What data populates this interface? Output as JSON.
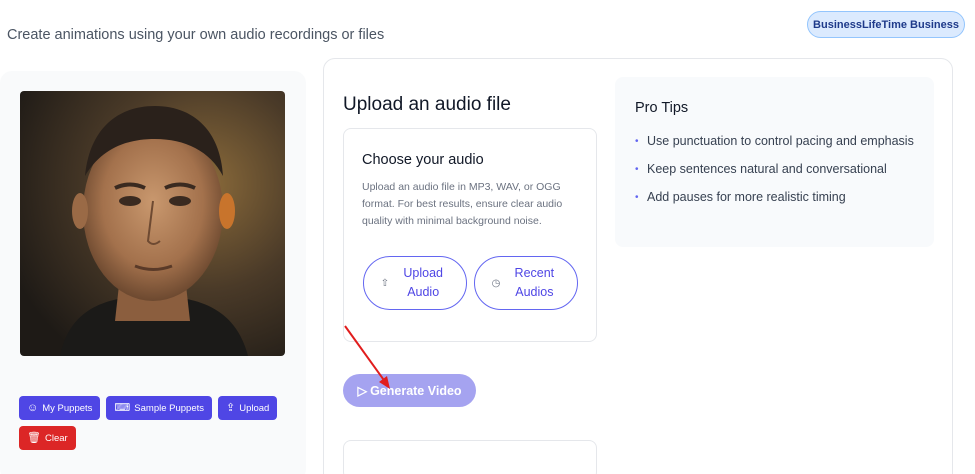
{
  "header": {
    "subtitle": "Create animations using your own audio recordings or files",
    "account": "BusinessLifeTime Business"
  },
  "puppet_panel": {
    "buttons": [
      {
        "label": "My Puppets",
        "icon": "puppets-icon"
      },
      {
        "label": "Sample Puppets",
        "icon": "keyboard-icon"
      },
      {
        "label": "Upload",
        "icon": "upload-icon"
      },
      {
        "label": "Clear",
        "icon": "trash-icon"
      }
    ]
  },
  "upload": {
    "title": "Upload an audio file",
    "choose_title": "Choose your audio",
    "choose_desc": "Upload an audio file in MP3, WAV, or OGG format. For best results, ensure clear audio quality with minimal background noise.",
    "upload_btn": "Upload Audio",
    "recent_btn": "Recent Audios",
    "generate_btn": "Generate Video"
  },
  "tips": {
    "title": "Pro Tips",
    "items": [
      "Use punctuation to control pacing and emphasis",
      "Keep sentences natural and conversational",
      "Add pauses for more realistic timing"
    ]
  },
  "colors": {
    "accent": "#4f46e5",
    "danger": "#dc2626",
    "annotation_arrow": "#e11d1d"
  }
}
